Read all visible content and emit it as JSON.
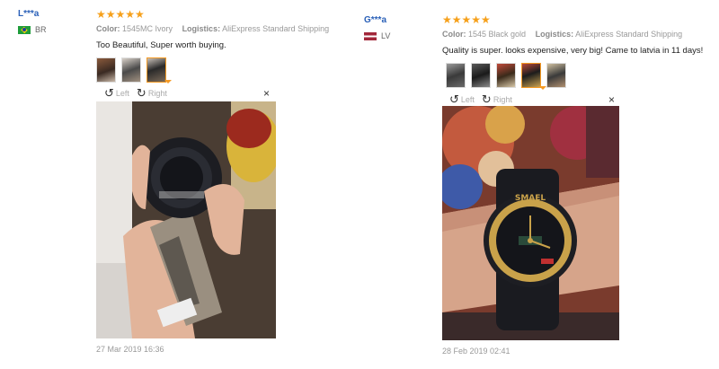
{
  "reviews": [
    {
      "user": {
        "name": "L***a",
        "country": "BR"
      },
      "stars": "★★★★★",
      "color_label": "Color:",
      "color_value": "1545MC Ivory",
      "logistics_label": "Logistics:",
      "logistics_value": "AliExpress Standard Shipping",
      "text": "Too Beautiful, Super worth buying.",
      "viewer": {
        "left": "Left",
        "right": "Right",
        "close": "×"
      },
      "date": "27 Mar 2019 16:36"
    },
    {
      "user": {
        "name": "G***a",
        "country": "LV"
      },
      "stars": "★★★★★",
      "color_label": "Color:",
      "color_value": "1545 Black gold",
      "logistics_label": "Logistics:",
      "logistics_value": "AliExpress Standard Shipping",
      "text": "Quality is super. looks expensive, very big! Came to latvia in 11 days!",
      "viewer": {
        "left": "Left",
        "right": "Right",
        "close": "×"
      },
      "date": "28 Feb 2019 02:41"
    }
  ],
  "icons": {
    "rotate_left": "rotate-left-icon",
    "rotate_right": "rotate-right-icon",
    "close": "close-icon",
    "star": "star-icon",
    "flag_br": "flag-br-icon",
    "flag_lv": "flag-lv-icon"
  },
  "colors": {
    "stars": "#f6a01a",
    "username": "#2a60b8",
    "active_thumb": "#f59a23"
  }
}
